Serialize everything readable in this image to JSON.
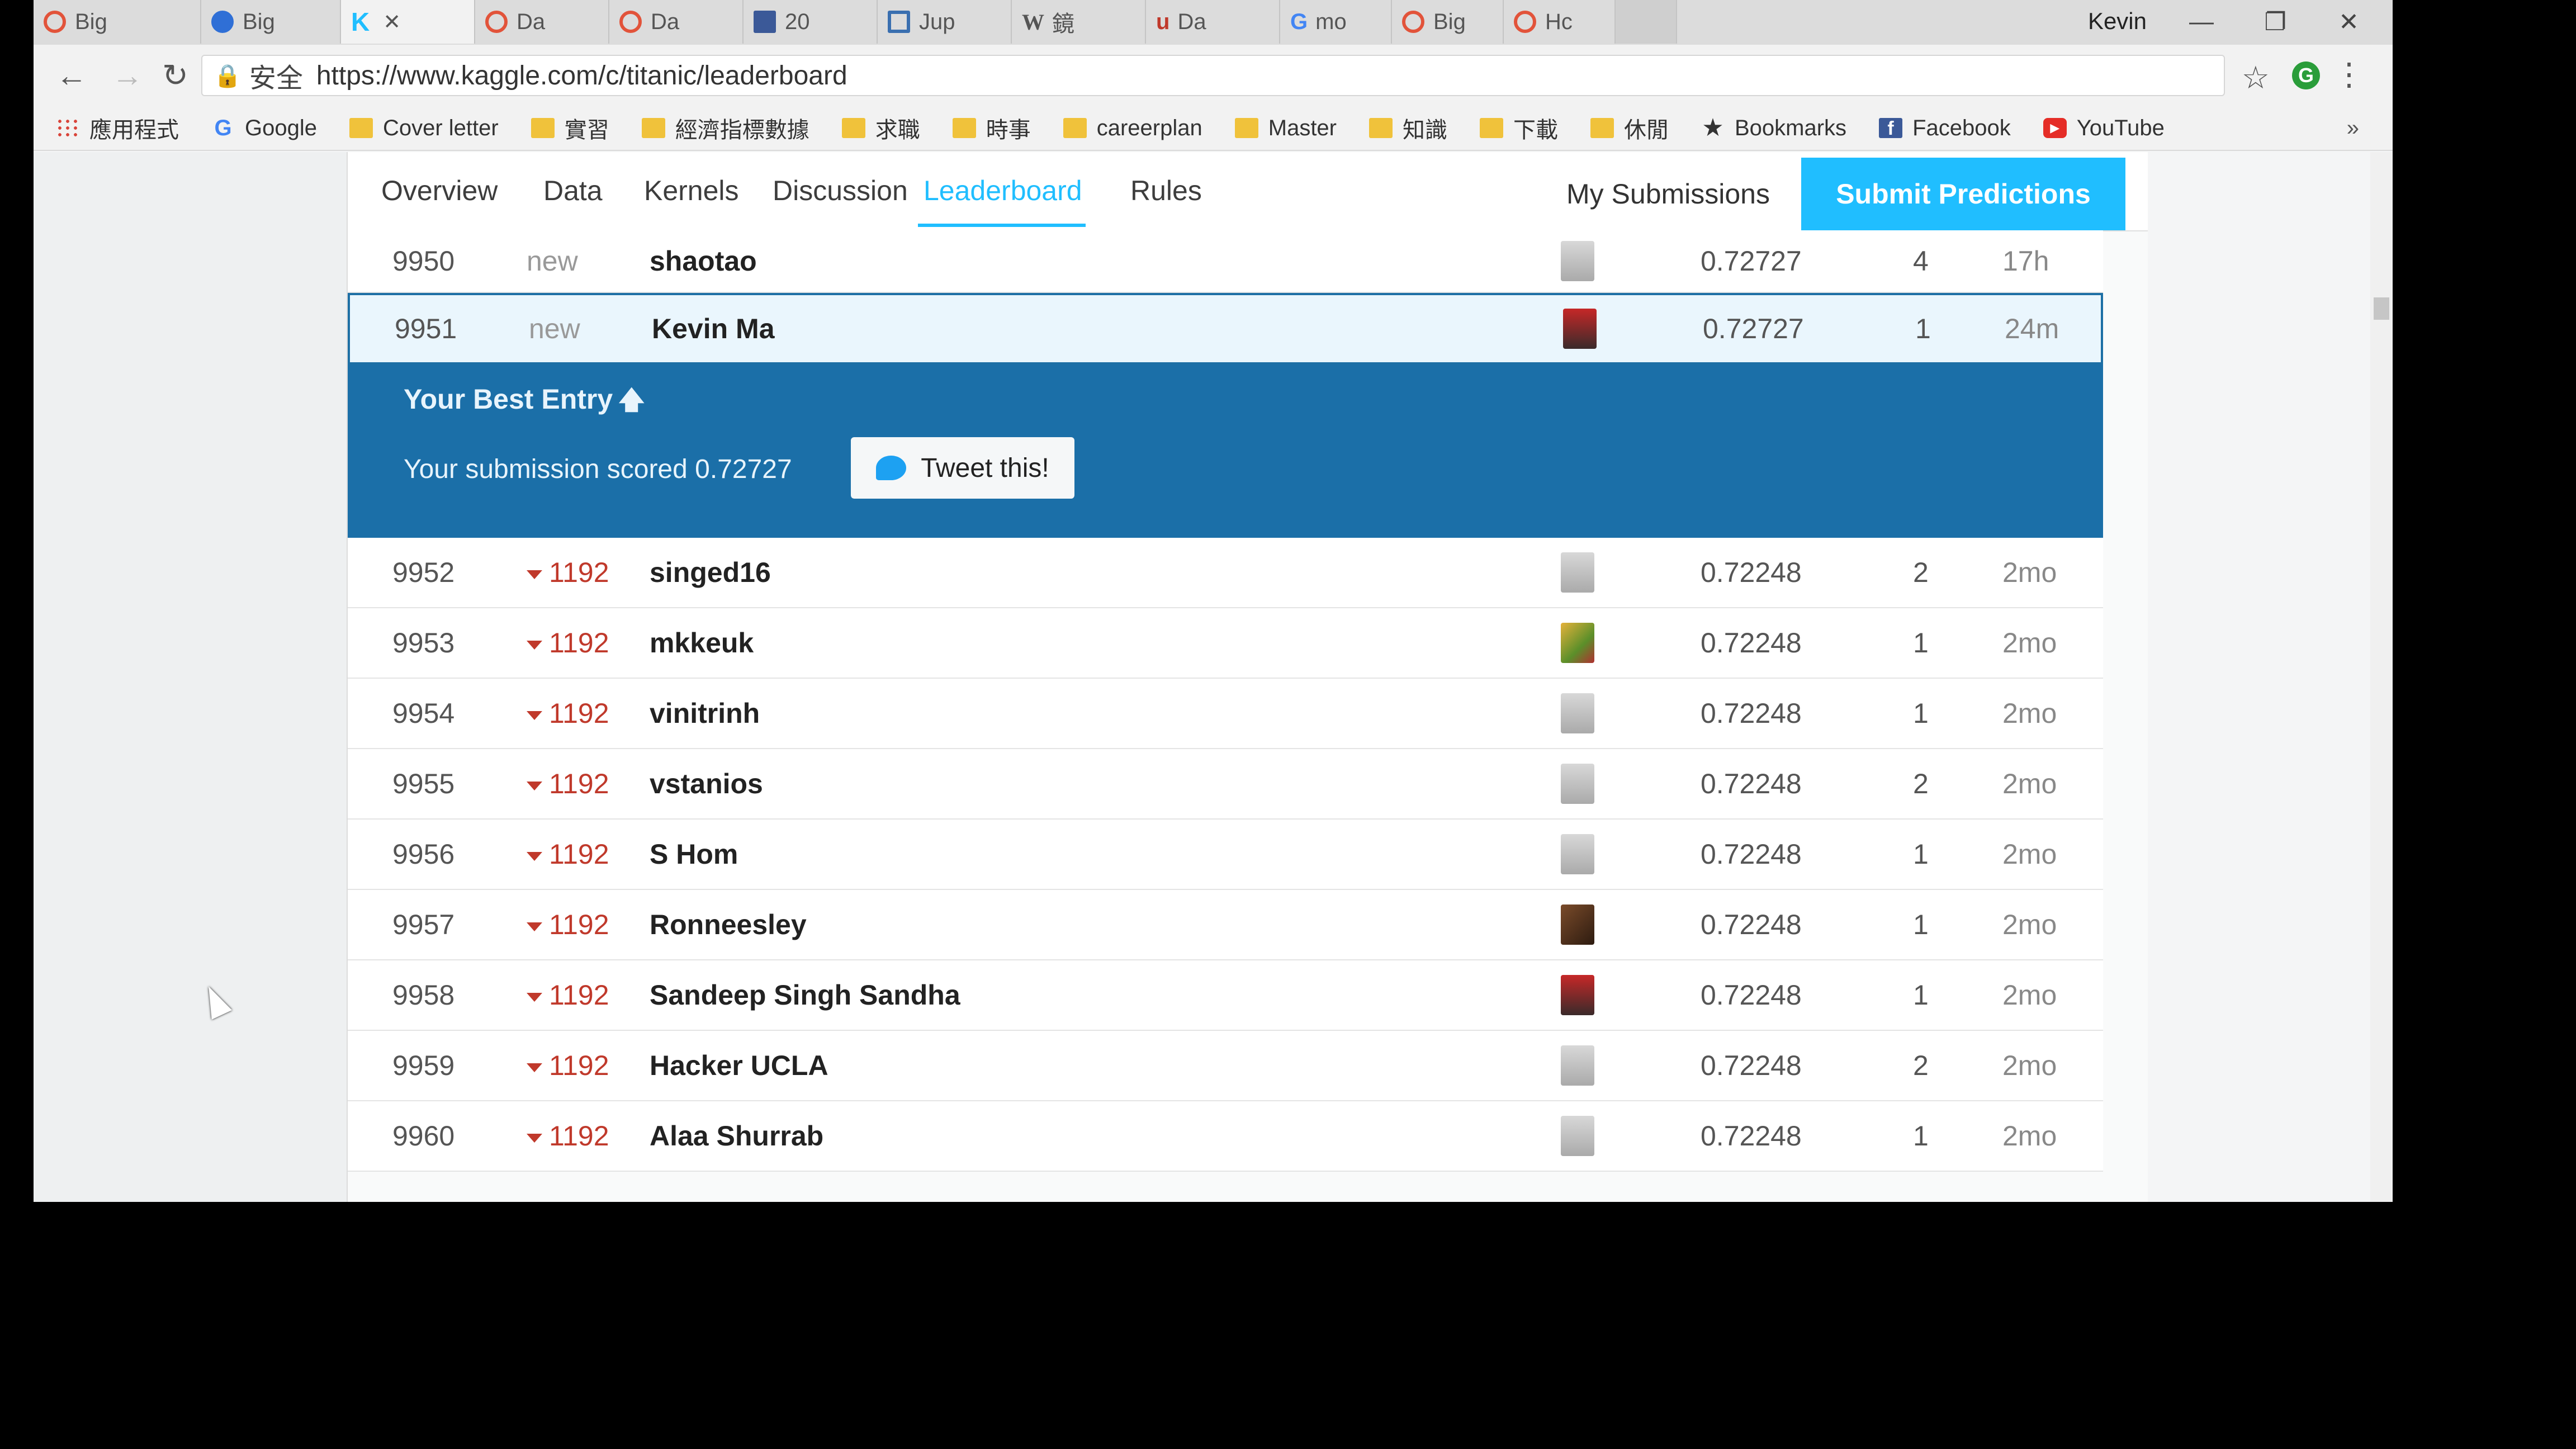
{
  "browser": {
    "tabs": [
      {
        "label": "Big"
      },
      {
        "label": "Big"
      },
      {
        "label": "K",
        "active": true
      },
      {
        "label": "Da"
      },
      {
        "label": "Da"
      },
      {
        "label": "20"
      },
      {
        "label": "Jup"
      },
      {
        "label": "鏡"
      },
      {
        "label": "Da"
      },
      {
        "label": "mo"
      },
      {
        "label": "Big"
      },
      {
        "label": "Hc"
      }
    ],
    "profile_name": "Kevin",
    "secure_label": "安全",
    "url": "https://www.kaggle.com/c/titanic/leaderboard",
    "bookmarks": [
      {
        "label": "應用程式",
        "icon": "apps-icon"
      },
      {
        "label": "Google",
        "icon": "google-icon"
      },
      {
        "label": "Cover letter",
        "icon": "folder-icon"
      },
      {
        "label": "實習",
        "icon": "folder-icon"
      },
      {
        "label": "經濟指標數據",
        "icon": "folder-icon"
      },
      {
        "label": "求職",
        "icon": "folder-icon"
      },
      {
        "label": "時事",
        "icon": "folder-icon"
      },
      {
        "label": "careerplan",
        "icon": "folder-icon"
      },
      {
        "label": "Master",
        "icon": "folder-icon"
      },
      {
        "label": "知識",
        "icon": "folder-icon"
      },
      {
        "label": "下載",
        "icon": "folder-icon"
      },
      {
        "label": "休閒",
        "icon": "folder-icon"
      },
      {
        "label": "Bookmarks",
        "icon": "star-icon"
      },
      {
        "label": "Facebook",
        "icon": "facebook-icon"
      },
      {
        "label": "YouTube",
        "icon": "youtube-icon"
      }
    ],
    "more_label": "»"
  },
  "competition_nav": {
    "tabs": [
      "Overview",
      "Data",
      "Kernels",
      "Discussion",
      "Leaderboard",
      "Rules"
    ],
    "active_tab": "Leaderboard",
    "my_submissions": "My Submissions",
    "submit_predictions": "Submit Predictions"
  },
  "leaderboard": {
    "rows_before": [
      {
        "rank": "9950",
        "delta": "new",
        "name": "shaotao",
        "score": "0.72727",
        "entries": "4",
        "last": "17h"
      }
    ],
    "my_row": {
      "rank": "9951",
      "delta": "new",
      "name": "Kevin Ma",
      "score": "0.72727",
      "entries": "1",
      "last": "24m"
    },
    "best_entry": {
      "title": "Your Best Entry",
      "text": "Your submission scored 0.72727",
      "tweet_label": "Tweet this!"
    },
    "rows_after": [
      {
        "rank": "9952",
        "delta": "1192",
        "name": "singed16",
        "score": "0.72248",
        "entries": "2",
        "last": "2mo"
      },
      {
        "rank": "9953",
        "delta": "1192",
        "name": "mkkeuk",
        "score": "0.72248",
        "entries": "1",
        "last": "2mo"
      },
      {
        "rank": "9954",
        "delta": "1192",
        "name": "vinitrinh",
        "score": "0.72248",
        "entries": "1",
        "last": "2mo"
      },
      {
        "rank": "9955",
        "delta": "1192",
        "name": "vstanios",
        "score": "0.72248",
        "entries": "2",
        "last": "2mo"
      },
      {
        "rank": "9956",
        "delta": "1192",
        "name": "S Hom",
        "score": "0.72248",
        "entries": "1",
        "last": "2mo"
      },
      {
        "rank": "9957",
        "delta": "1192",
        "name": "Ronneesley",
        "score": "0.72248",
        "entries": "1",
        "last": "2mo"
      },
      {
        "rank": "9958",
        "delta": "1192",
        "name": "Sandeep Singh Sandha",
        "score": "0.72248",
        "entries": "1",
        "last": "2mo"
      },
      {
        "rank": "9959",
        "delta": "1192",
        "name": "Hacker UCLA",
        "score": "0.72248",
        "entries": "2",
        "last": "2mo"
      },
      {
        "rank": "9960",
        "delta": "1192",
        "name": "Alaa Shurrab",
        "score": "0.72248",
        "entries": "1",
        "last": "2mo"
      }
    ]
  },
  "colors": {
    "kaggle_blue": "#20beff",
    "best_entry_bg": "#1b6fa8",
    "rank_down": "#c0392b"
  }
}
